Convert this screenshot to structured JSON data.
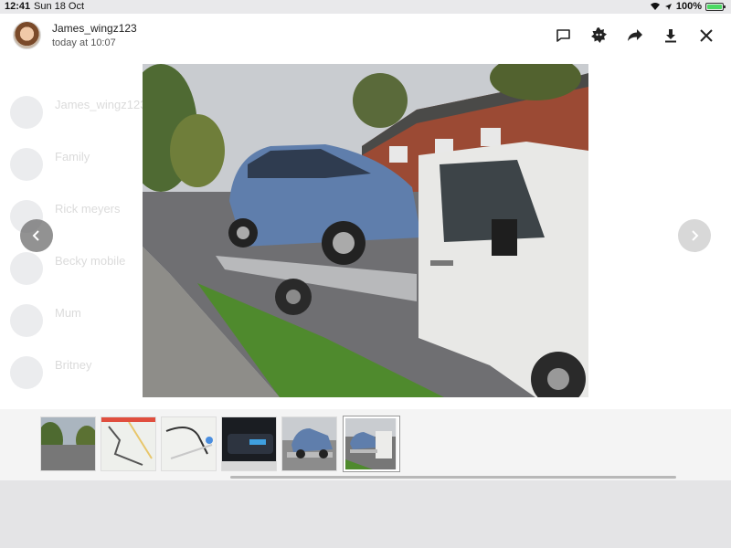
{
  "status": {
    "time": "12:41",
    "date": "Sun 18 Oct",
    "battery": "100%",
    "battery_level": 1.0
  },
  "header": {
    "username": "James_wingz123",
    "timestamp": "today at 10:07",
    "actions": [
      "comment-icon",
      "sticker-icon",
      "forward-icon",
      "download-icon",
      "close-icon"
    ]
  },
  "background_chats": [
    {
      "name": "James_wingz123"
    },
    {
      "name": "Family"
    },
    {
      "name": "Rick meyers"
    },
    {
      "name": "Becky mobile"
    },
    {
      "name": "Mum"
    },
    {
      "name": "Britney"
    }
  ],
  "thumbnails": [
    {
      "name": "thumb-street-photo",
      "selected": false
    },
    {
      "name": "thumb-map-route",
      "selected": false
    },
    {
      "name": "thumb-map-route-2",
      "selected": false
    },
    {
      "name": "thumb-dashboard-photo",
      "selected": false
    },
    {
      "name": "thumb-truck-photo",
      "selected": false
    },
    {
      "name": "thumb-truck-photo-2",
      "selected": true
    }
  ],
  "colors": {
    "battery": "#4cd964",
    "background": "#ffffff",
    "strip": "#f4f4f4"
  }
}
